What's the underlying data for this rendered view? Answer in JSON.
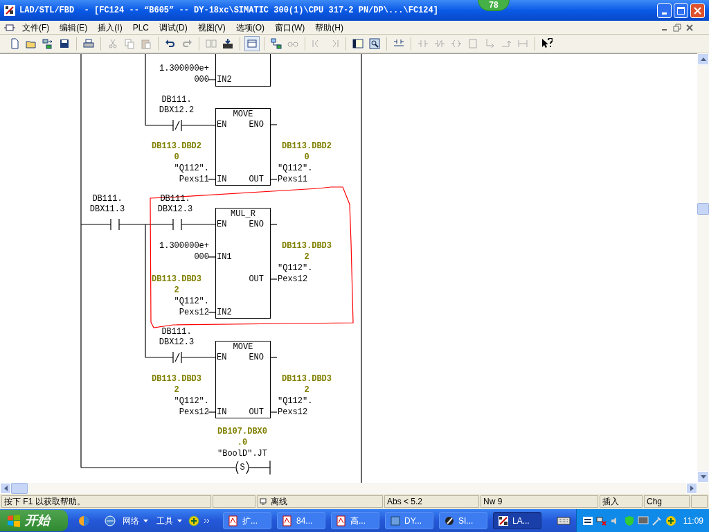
{
  "window": {
    "title": "LAD/STL/FBD  - [FC124 -- “B605” -- DY-18xc\\SIMATIC 300(1)\\CPU 317-2 PN/DP\\...\\FC124]",
    "badge": "78"
  },
  "menu": [
    "文件(F)",
    "编辑(E)",
    "插入(I)",
    "PLC",
    "调试(D)",
    "视图(V)",
    "选项(O)",
    "窗口(W)",
    "帮助(H)"
  ],
  "toolbar": [
    {
      "disabled": false,
      "pressed": false
    },
    {
      "disabled": false,
      "pressed": false
    },
    {
      "disabled": false,
      "pressed": false
    },
    {
      "disabled": false,
      "pressed": false
    },
    {
      "disabled": false,
      "pressed": false
    },
    {
      "disabled": true,
      "pressed": false
    },
    {
      "disabled": true,
      "pressed": false
    },
    {
      "disabled": true,
      "pressed": false
    },
    {
      "disabled": false,
      "pressed": false
    },
    {
      "disabled": true,
      "pressed": false
    },
    {
      "disabled": true,
      "pressed": false
    },
    {
      "disabled": false,
      "pressed": false
    },
    {
      "disabled": false,
      "pressed": true
    },
    {
      "disabled": false,
      "pressed": false
    },
    {
      "disabled": true,
      "pressed": false
    },
    {
      "disabled": true,
      "pressed": false
    },
    {
      "disabled": true,
      "pressed": false
    },
    {
      "disabled": false,
      "pressed": false
    },
    {
      "disabled": false,
      "pressed": false
    },
    {
      "disabled": false,
      "pressed": false
    },
    {
      "disabled": true,
      "pressed": false
    },
    {
      "disabled": true,
      "pressed": false
    },
    {
      "disabled": true,
      "pressed": false
    },
    {
      "disabled": true,
      "pressed": false
    },
    {
      "disabled": true,
      "pressed": false
    },
    {
      "disabled": true,
      "pressed": false
    },
    {
      "disabled": true,
      "pressed": false
    },
    {
      "disabled": false,
      "pressed": false
    }
  ],
  "ladder": {
    "elements": [
      {
        "kind": "box",
        "pins": [
          {
            "label": "IN2",
            "operand": [
              {
                "text": "1.300000e+",
                "kind": "constant"
              },
              {
                "text": "000",
                "kind": "constant"
              }
            ]
          }
        ]
      },
      {
        "kind": "contact_nc",
        "address": [
          "DB111.",
          "DBX12.2"
        ]
      },
      {
        "kind": "box",
        "title": "MOVE",
        "pins": [
          {
            "label": "EN"
          },
          {
            "label": "ENO"
          },
          {
            "label": "IN",
            "operand": [
              {
                "text": "DB113.DBD2",
                "kind": "address"
              },
              {
                "text": "0",
                "kind": "address"
              },
              {
                "text": "″Q112″.",
                "kind": "symbol"
              },
              {
                "text": "Pexs11",
                "kind": "symbol"
              }
            ]
          },
          {
            "label": "OUT",
            "operand": [
              {
                "text": "DB113.DBD2",
                "kind": "address"
              },
              {
                "text": "0",
                "kind": "address"
              },
              {
                "text": "″Q112″.",
                "kind": "symbol"
              },
              {
                "text": "Pexs11",
                "kind": "symbol"
              }
            ]
          }
        ]
      },
      {
        "kind": "contact_no",
        "address": [
          "DB111.",
          "DBX11.3"
        ]
      },
      {
        "kind": "contact_no",
        "address": [
          "DB111.",
          "DBX12.3"
        ]
      },
      {
        "kind": "box",
        "title": "MUL_R",
        "pins": [
          {
            "label": "EN"
          },
          {
            "label": "ENO"
          },
          {
            "label": "IN1",
            "operand": [
              {
                "text": "1.300000e+",
                "kind": "constant"
              },
              {
                "text": "000",
                "kind": "constant"
              }
            ]
          },
          {
            "label": "OUT",
            "operand": [
              {
                "text": "DB113.DBD3",
                "kind": "address"
              },
              {
                "text": "2",
                "kind": "address"
              },
              {
                "text": "″Q112″.",
                "kind": "symbol"
              },
              {
                "text": "Pexs12",
                "kind": "symbol"
              }
            ]
          },
          {
            "label": "IN2",
            "operand": [
              {
                "text": "DB113.DBD3",
                "kind": "address"
              },
              {
                "text": "2",
                "kind": "address"
              },
              {
                "text": "″Q112″.",
                "kind": "symbol"
              },
              {
                "text": "Pexs12",
                "kind": "symbol"
              }
            ]
          }
        ]
      },
      {
        "kind": "contact_nc",
        "address": [
          "DB111.",
          "DBX12.3"
        ]
      },
      {
        "kind": "box",
        "title": "MOVE",
        "pins": [
          {
            "label": "EN"
          },
          {
            "label": "ENO"
          },
          {
            "label": "IN",
            "operand": [
              {
                "text": "DB113.DBD3",
                "kind": "address"
              },
              {
                "text": "2",
                "kind": "address"
              },
              {
                "text": "″Q112″.",
                "kind": "symbol"
              },
              {
                "text": "Pexs12",
                "kind": "symbol"
              }
            ]
          },
          {
            "label": "OUT",
            "operand": [
              {
                "text": "DB113.DBD3",
                "kind": "address"
              },
              {
                "text": "2",
                "kind": "address"
              },
              {
                "text": "″Q112″.",
                "kind": "symbol"
              },
              {
                "text": "Pexs12",
                "kind": "symbol"
              }
            ]
          }
        ]
      },
      {
        "kind": "coil",
        "letter": "S",
        "operand": [
          {
            "text": "DB107.DBX0",
            "kind": "address"
          },
          {
            "text": ".0",
            "kind": "address"
          },
          {
            "text": "″BoolD″.JT",
            "kind": "symbol"
          }
        ]
      }
    ]
  },
  "status_bar": {
    "help": "按下 F1 以获取帮助。",
    "connection": "离线",
    "position": "Abs < 5.2",
    "network": "Nw 9",
    "mode": "插入",
    "change": "Chg"
  },
  "taskbar": {
    "start": "开始",
    "quick_launch": [
      "网络",
      "工具"
    ],
    "tasks": [
      {
        "label": "扩...",
        "selected": false
      },
      {
        "label": "84...",
        "selected": false
      },
      {
        "label": "高...",
        "selected": false
      },
      {
        "label": "DY...",
        "selected": false
      },
      {
        "label": "SI...",
        "selected": false
      },
      {
        "label": "LA...",
        "selected": true
      }
    ],
    "clock": "11:09"
  }
}
